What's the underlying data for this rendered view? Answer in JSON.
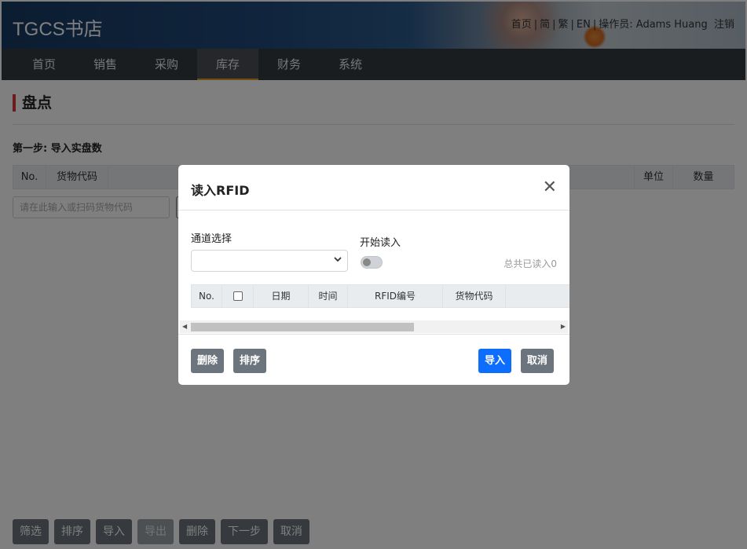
{
  "header": {
    "brand": "TGCS书店",
    "links": {
      "home": "首页",
      "simplified": "简",
      "traditional": "繁",
      "english": "EN",
      "operator_label": "操作员:",
      "operator_name": "Adams Huang",
      "logout": "注销",
      "sep": "|"
    }
  },
  "nav": {
    "items": [
      {
        "label": "首页"
      },
      {
        "label": "销售"
      },
      {
        "label": "采购"
      },
      {
        "label": "库存"
      },
      {
        "label": "财务"
      },
      {
        "label": "系统"
      }
    ],
    "active": "库存"
  },
  "page": {
    "title": "盘点",
    "step": "第一步: 导入实盘数",
    "grid_columns": {
      "no": "No.",
      "code": "货物代码",
      "unit": "单位",
      "qty": "数量"
    },
    "scan_placeholder": "请在此输入或扫码货物代码"
  },
  "bottom_buttons": {
    "filter": "筛选",
    "sort": "排序",
    "import": "导入",
    "export": "导出",
    "delete": "删除",
    "next": "下一步",
    "cancel": "取消"
  },
  "modal": {
    "title": "读入RFID",
    "close_glyph": "✕",
    "channel_label": "通道选择",
    "channel_value": "",
    "start_label": "开始读入",
    "total_read": "总共已读入0",
    "columns": {
      "no": "No.",
      "date": "日期",
      "time": "时间",
      "rfid": "RFID编号",
      "code": "货物代码"
    },
    "buttons": {
      "delete": "删除",
      "sort": "排序",
      "import": "导入",
      "cancel": "取消"
    }
  },
  "colors": {
    "nav_bg": "#343a40",
    "primary": "#0d6efd",
    "secondary": "#6c757d",
    "title_accent": "#d9363e",
    "nav_active_underline": "#e0a020"
  }
}
